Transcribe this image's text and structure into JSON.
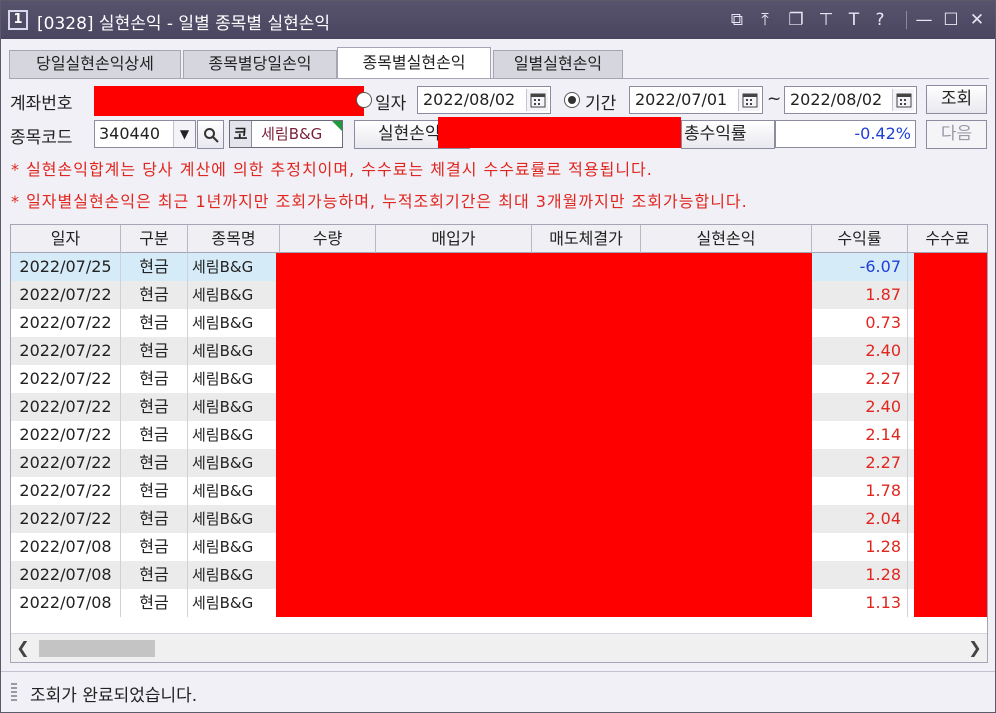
{
  "window": {
    "number": "1",
    "title": "[0328] 실현손익 - 일별 종목별 실현손익",
    "icons": [
      "restore-icon",
      "pin-top-icon",
      "copy-icon",
      "pin-icon",
      "text-icon",
      "help-icon",
      "minimize-icon",
      "maximize-icon",
      "close-icon"
    ],
    "icon_glyphs": [
      "⧉",
      "⤒",
      "❐",
      "⊤",
      "T",
      "?",
      "—",
      "☐",
      "✕"
    ]
  },
  "tabs": [
    {
      "label": "당일실현손익상세"
    },
    {
      "label": "종목별당일손익"
    },
    {
      "label": "종목별실현손익"
    },
    {
      "label": "일별실현손익"
    }
  ],
  "form": {
    "account_label": "계좌번호",
    "date_label": "일자",
    "date_value": "2022/08/02",
    "period_label": "기간",
    "period_start": "2022/07/01",
    "period_sep": "~",
    "period_end": "2022/08/02",
    "query_button": "조회",
    "code_label": "종목코드",
    "code_value": "340440",
    "code_prefix": "코",
    "stock_name": "세림B&G",
    "realized_button": "실현손익",
    "total_rate_label": "총수익률",
    "total_rate_value": "-0.42%",
    "next_button": "다음"
  },
  "notices": [
    "* 실현손익합계는 당사 계산에 의한 추정치이며, 수수료는 체결시 수수료률로 적용됩니다.",
    "* 일자별실현손익은 최근 1년까지만 조회가능하며, 누적조회기간은 최대 3개월까지만 조회가능합니다."
  ],
  "table": {
    "columns": [
      "일자",
      "구분",
      "종목명",
      "수량",
      "매입가",
      "매도체결가",
      "실현손익",
      "수익률",
      "수수료"
    ],
    "rows": [
      {
        "date": "2022/07/25",
        "type": "현금",
        "name": "세림B&G",
        "rate": "-6.07"
      },
      {
        "date": "2022/07/22",
        "type": "현금",
        "name": "세림B&G",
        "rate": "1.87"
      },
      {
        "date": "2022/07/22",
        "type": "현금",
        "name": "세림B&G",
        "rate": "0.73"
      },
      {
        "date": "2022/07/22",
        "type": "현금",
        "name": "세림B&G",
        "rate": "2.40"
      },
      {
        "date": "2022/07/22",
        "type": "현금",
        "name": "세림B&G",
        "rate": "2.27"
      },
      {
        "date": "2022/07/22",
        "type": "현금",
        "name": "세림B&G",
        "rate": "2.40"
      },
      {
        "date": "2022/07/22",
        "type": "현금",
        "name": "세림B&G",
        "rate": "2.14"
      },
      {
        "date": "2022/07/22",
        "type": "현금",
        "name": "세림B&G",
        "rate": "2.27"
      },
      {
        "date": "2022/07/22",
        "type": "현금",
        "name": "세림B&G",
        "rate": "1.78"
      },
      {
        "date": "2022/07/22",
        "type": "현금",
        "name": "세림B&G",
        "rate": "2.04"
      },
      {
        "date": "2022/07/08",
        "type": "현금",
        "name": "세림B&G",
        "rate": "1.28"
      },
      {
        "date": "2022/07/08",
        "type": "현금",
        "name": "세림B&G",
        "rate": "1.28"
      },
      {
        "date": "2022/07/08",
        "type": "현금",
        "name": "세림B&G",
        "rate": "1.13"
      }
    ]
  },
  "status": "조회가 완료되었습니다.",
  "colors": {
    "title_bar": "#4f4a65",
    "notice_red": "#e0261f",
    "positive_red": "#e0261f",
    "negative_blue": "#1f3fd6",
    "selected_row": "#d6ebf8",
    "alt_row": "#ebebeb",
    "redaction": "#ff0000"
  }
}
